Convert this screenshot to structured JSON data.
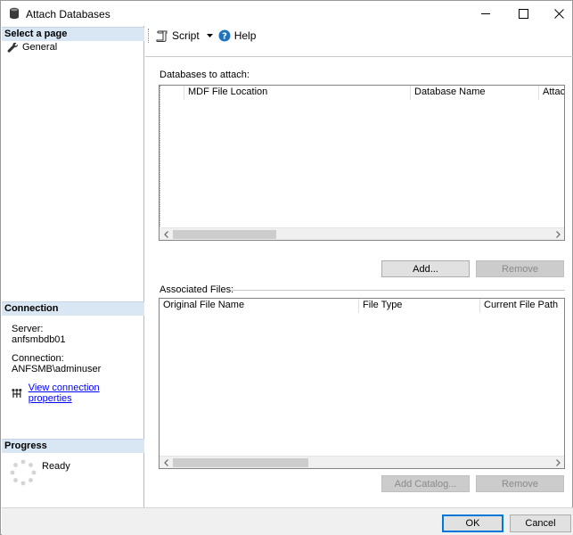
{
  "window": {
    "title": "Attach Databases",
    "icon": "database-icon",
    "controls": [
      "minimize-icon",
      "maximize-icon",
      "close-icon"
    ]
  },
  "left_panel": {
    "select_page": {
      "header": "Select a page",
      "items": [
        {
          "label": "General",
          "icon": "wrench-icon"
        }
      ]
    },
    "connection": {
      "header": "Connection",
      "server_label": "Server:",
      "server_value": "anfsmbdb01",
      "connection_label": "Connection:",
      "connection_value": "ANFSMB\\adminuser",
      "view_props_link": "View connection properties"
    },
    "progress": {
      "header": "Progress",
      "status": "Ready"
    }
  },
  "toolbar": {
    "script_label": "Script",
    "help_label": "Help"
  },
  "databases": {
    "label": "Databases to attach:",
    "columns": [
      "",
      "MDF File Location",
      "Database Name",
      "Attach"
    ],
    "rows": [],
    "add_button": "Add...",
    "remove_button": "Remove"
  },
  "associated_files": {
    "label": "Associated Files:",
    "columns": [
      "Original File Name",
      "File Type",
      "Current File Path"
    ],
    "rows": [],
    "add_catalog_button": "Add Catalog...",
    "remove_button": "Remove"
  },
  "footer": {
    "ok_button": "OK",
    "cancel_button": "Cancel"
  },
  "colors": {
    "section_header_bg": "#d9e6f3",
    "link": "#0000ff",
    "primary_border": "#0078d7"
  }
}
